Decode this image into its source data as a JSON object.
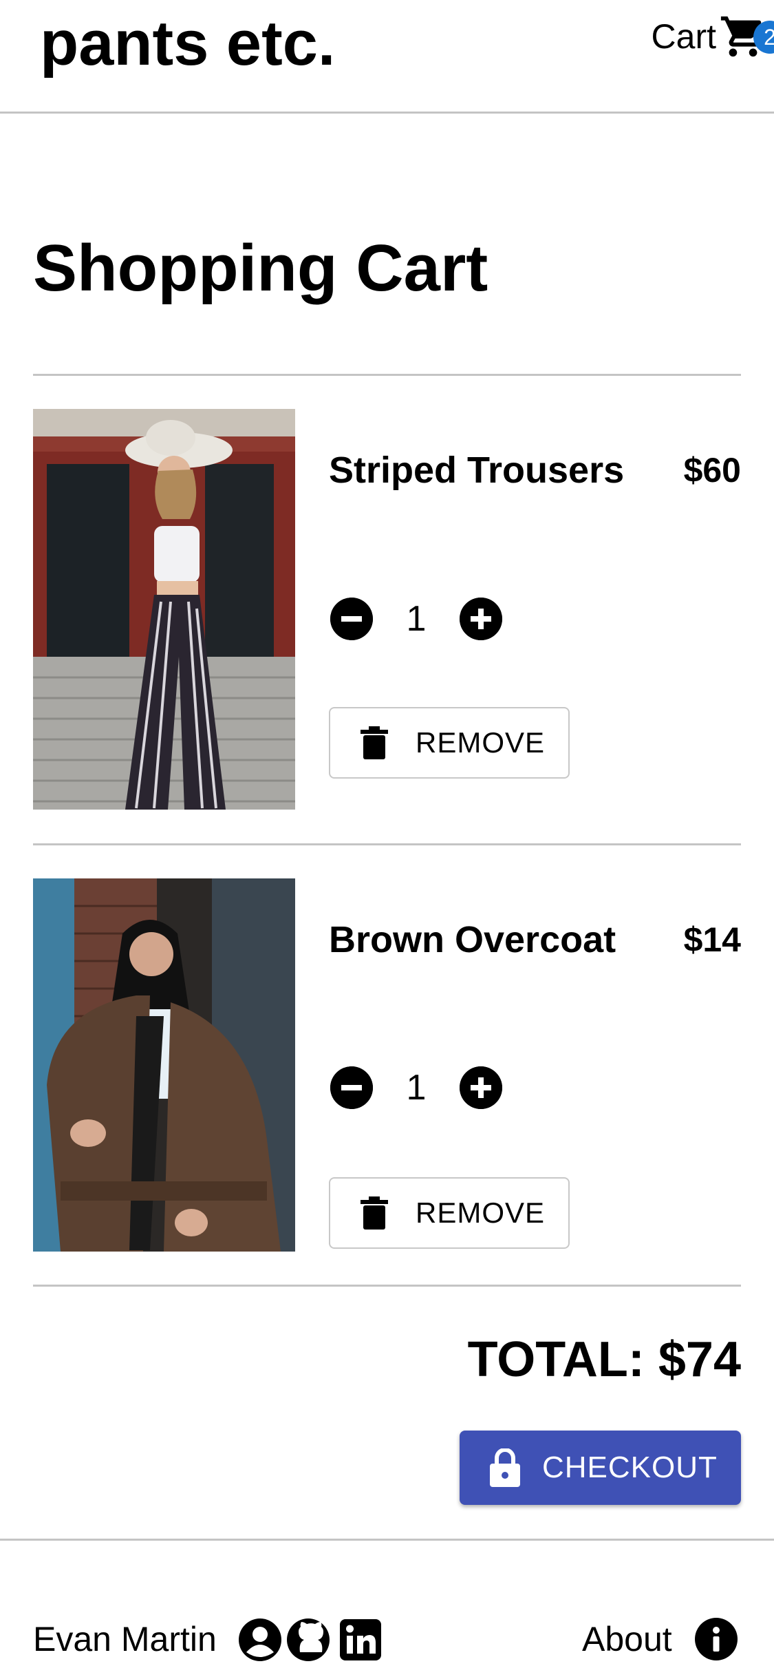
{
  "header": {
    "logo": "pants etc.",
    "cart_label": "Cart",
    "cart_count": "2"
  },
  "page_title": "Shopping Cart",
  "items": [
    {
      "name": "Striped Trousers",
      "price": "$60",
      "quantity": "1",
      "remove_label": "REMOVE"
    },
    {
      "name": "Brown Overcoat",
      "price": "$14",
      "quantity": "1",
      "remove_label": "REMOVE"
    }
  ],
  "total": "TOTAL: $74",
  "checkout_label": "CHECKOUT",
  "footer": {
    "author": "Evan Martin",
    "about_label": "About"
  },
  "colors": {
    "badge": "#1976d2",
    "checkout": "#3f51b5",
    "divider": "#c4c4c4"
  },
  "icons": [
    "cart-icon",
    "minus-circle-icon",
    "plus-circle-icon",
    "trash-icon",
    "lock-icon",
    "user-circle-icon",
    "github-icon",
    "linkedin-icon",
    "info-icon"
  ]
}
